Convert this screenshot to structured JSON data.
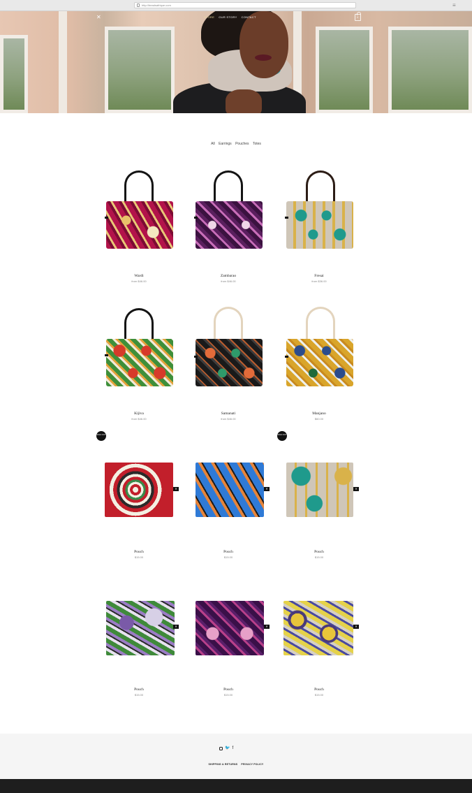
{
  "browser": {
    "url": "http://beadsafrique.com",
    "menu_label": "≡"
  },
  "header": {
    "logo_glyph": "✕",
    "nav": [
      "STORE",
      "OUR STORY",
      "CONTACT"
    ],
    "cart_count": "0"
  },
  "filters": [
    "All",
    "Earrings",
    "Pouches",
    "Totes"
  ],
  "products": [
    {
      "name": "Wardi",
      "price": "from $46.00"
    },
    {
      "name": "Zambarao",
      "price": "from $46.00"
    },
    {
      "name": "Fresai",
      "price": "from $36.00"
    },
    {
      "name": "Kijiva",
      "price": "from $46.00"
    },
    {
      "name": "Samanati",
      "price": "from $46.00"
    },
    {
      "name": "Manjano",
      "price": "$60.00"
    },
    {
      "name": "Pouch",
      "price": "$15.00"
    },
    {
      "name": "Pouch",
      "price": "$15.00"
    },
    {
      "name": "Pouch",
      "price": "$15.00"
    },
    {
      "name": "Pouch",
      "price": "$15.00"
    },
    {
      "name": "Pouch",
      "price": "$15.00"
    },
    {
      "name": "Pouch",
      "price": "$15.00"
    }
  ],
  "badges": {
    "sale": "SOLD OUT"
  },
  "footer": {
    "social_icons": [
      "instagram-icon",
      "twitter-icon",
      "facebook-icon"
    ],
    "links": [
      "SHIPPING & RETURNS",
      "PRIVACY POLICY"
    ]
  },
  "colors": {
    "accent_nav": "#e8d9a0",
    "footer_bg": "#f5f5f5",
    "bottom_bar": "#1e1e1e"
  }
}
